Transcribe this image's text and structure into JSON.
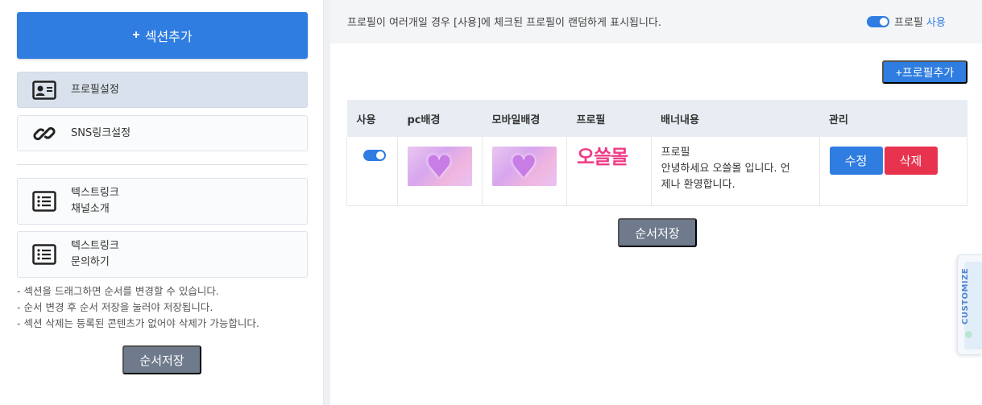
{
  "left_panel": {
    "add_section_label": "섹션추가",
    "menu": [
      {
        "label": "프로필설정",
        "icon": "profile-card-icon"
      },
      {
        "label": "SNS링크설정",
        "icon": "link-icon"
      },
      {
        "label_line1": "텍스트링크",
        "label_line2": "채널소개",
        "icon": "list-icon"
      },
      {
        "label_line1": "텍스트링크",
        "label_line2": "문의하기",
        "icon": "list-icon"
      }
    ],
    "notes": [
      "- 섹션을 드래그하면 순서를 변경할 수 있습니다.",
      "- 순서 변경 후 순서 저장을 눌러야 저장됩니다.",
      "- 섹션 삭제는 등록된 콘텐츠가 없어야 삭제가 가능합니다."
    ],
    "save_order_label": "순서저장"
  },
  "right_panel": {
    "notice": "프로필이 여러개일 경우 [사용]에 체크된 프로필이 랜덤하게 표시됩니다.",
    "profile_use_label_1": "프로필",
    "profile_use_label_2": "사용",
    "add_profile_label": "+프로필추가",
    "table": {
      "headers": [
        "사용",
        "pc배경",
        "모바일배경",
        "프로필",
        "배너내용",
        "관리"
      ],
      "rows": [
        {
          "enabled": true,
          "profile_logo_text": "오쓸몰",
          "banner_title": "프로필",
          "banner_body_line1": "안녕하세요 오쓸몰 입니다. 언",
          "banner_body_line2": "제나 환영합니다.",
          "edit_label": "수정",
          "delete_label": "삭제"
        }
      ]
    },
    "save_order_label": "순서저장"
  },
  "customize_tab": {
    "label": "CUSTOMIZE"
  },
  "colors": {
    "primary": "#2f7de1",
    "danger": "#e8334f",
    "secondary": "#6f7b8c",
    "logo_pink": "#ee3c87"
  }
}
